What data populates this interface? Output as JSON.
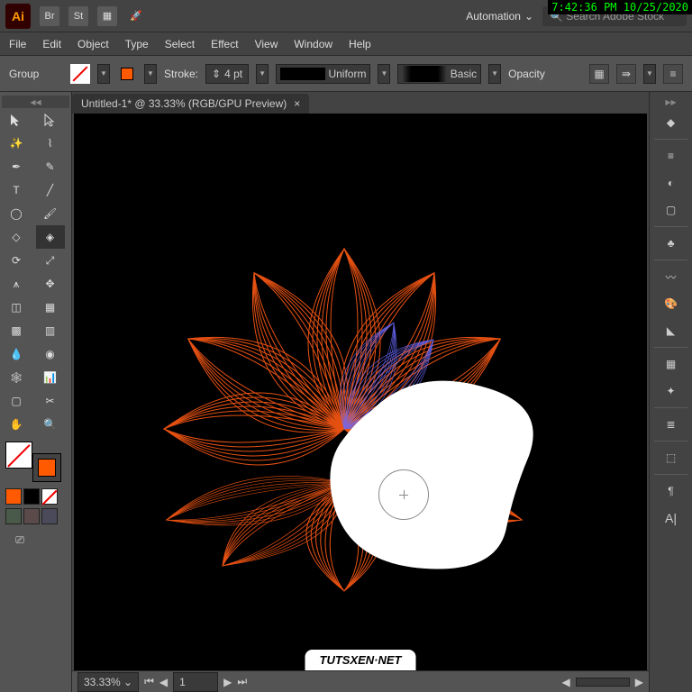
{
  "timestamp": "7:42:36 PM 10/25/2020",
  "app_logo": "Ai",
  "workspace": "Automation",
  "search_placeholder": "Search Adobe Stock",
  "menubar": [
    "File",
    "Edit",
    "Object",
    "Type",
    "Select",
    "Effect",
    "View",
    "Window",
    "Help"
  ],
  "control": {
    "selection_label": "Group",
    "stroke_label": "Stroke:",
    "stroke_width": "4 pt",
    "stroke_profile": "Uniform",
    "brush": "Basic",
    "opacity_label": "Opacity"
  },
  "tab_title": "Untitled-1* @ 33.33% (RGB/GPU Preview)",
  "zoom": "33.33%",
  "page_number": "1",
  "watermark": "TUTSXEN·NET",
  "swatches": [
    "#ff5a00",
    "#000000"
  ]
}
